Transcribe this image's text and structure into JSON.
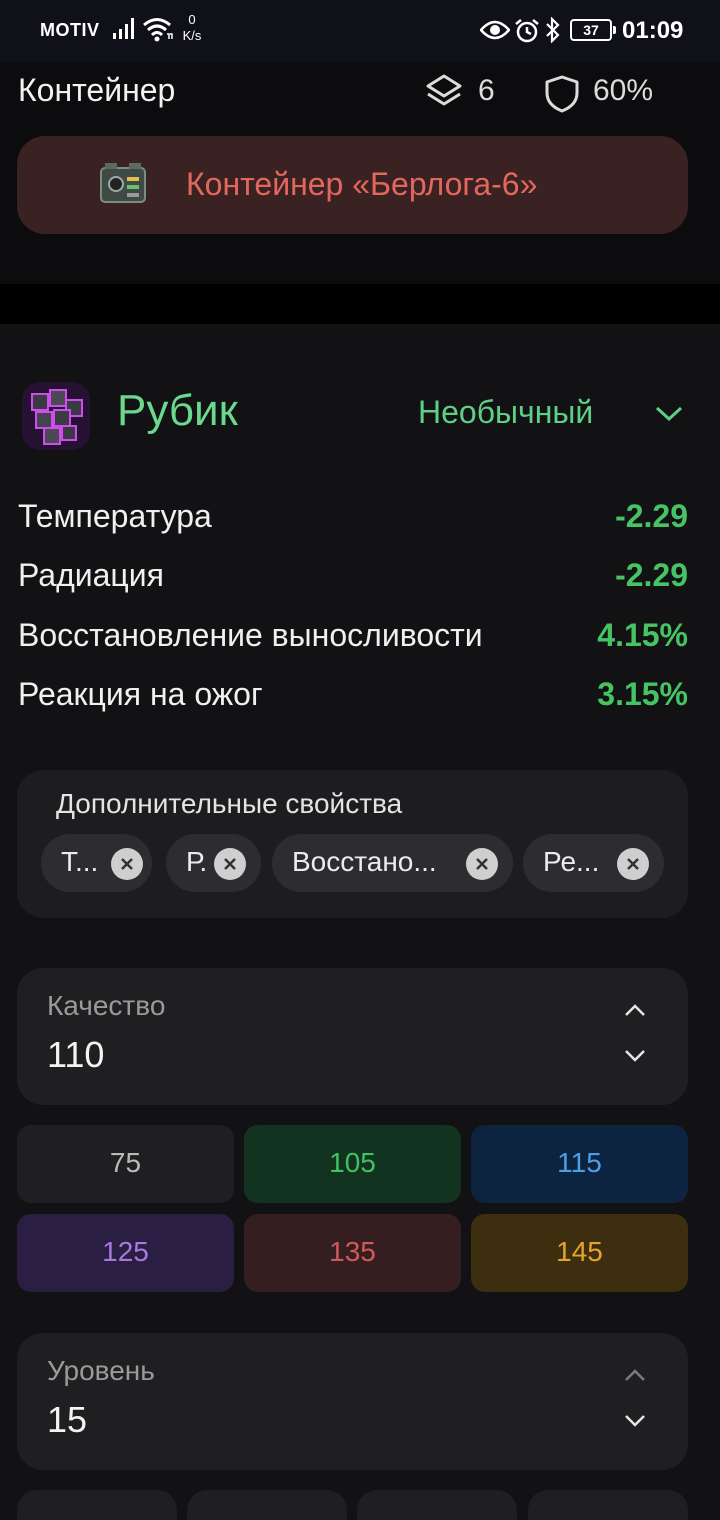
{
  "status_bar": {
    "carrier": "MOTIV",
    "net_speed_value": "0",
    "net_speed_unit": "K/s",
    "battery": "37",
    "time": "01:09"
  },
  "header": {
    "title": "Контейнер",
    "layers_count": "6",
    "protection": "60%",
    "container_name": "Контейнер «Берлога-6»"
  },
  "artifact": {
    "name": "Рубик",
    "rarity": "Необычный",
    "colors": {
      "name": "#6ad98f",
      "value": "#46c464",
      "container": "#e2675f"
    },
    "stats": [
      {
        "name": "Температура",
        "value": "-2.29"
      },
      {
        "name": "Радиация",
        "value": "-2.29"
      },
      {
        "name": "Восстановление выносливости",
        "value": "4.15%"
      },
      {
        "name": "Реакция на ожог",
        "value": "3.15%"
      }
    ]
  },
  "extra_props": {
    "label": "Дополнительные свойства",
    "chips": [
      "Т...",
      "Р.",
      "Восстано...",
      "Ре..."
    ]
  },
  "quality": {
    "label": "Качество",
    "value": "110",
    "presets": [
      "75",
      "105",
      "115",
      "125",
      "135",
      "145"
    ]
  },
  "level": {
    "label": "Уровень",
    "value": "15"
  }
}
